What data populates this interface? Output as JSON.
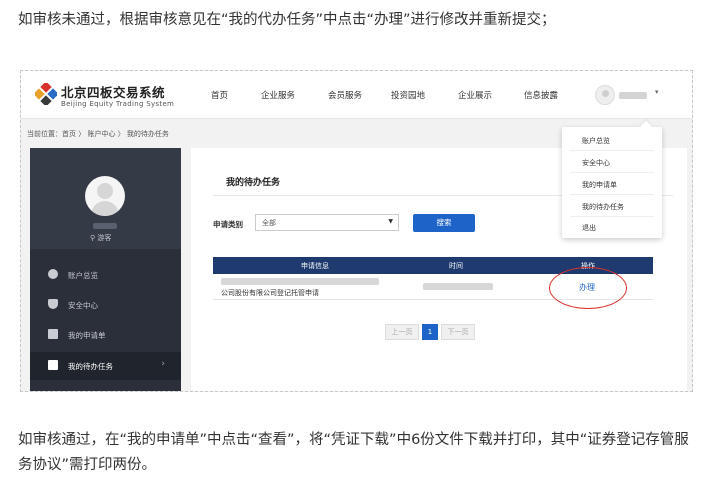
{
  "captions": {
    "top": "如审核未通过，根据审核意见在“我的代办任务”中点击“办理”进行修改并重新提交；",
    "bottom": "如审核通过，在“我的申请单”中点击“查看”，将“凭证下载”中6份文件下载并打印，其中“证券登记存管服务协议”需打印两份。"
  },
  "header": {
    "logo_cn": "北京四板交易系统",
    "logo_en": "Beijing Equity Trading System",
    "nav": [
      "首页",
      "企业服务",
      "会员服务",
      "投资园地",
      "企业展示",
      "信息披露"
    ],
    "user_caret": "▾"
  },
  "breadcrumb": "当前位置：首页 〉 账户中心 〉 我的待办任务",
  "sidebar": {
    "role": "游客",
    "items": [
      {
        "label": "账户总览",
        "icon": "account-icon"
      },
      {
        "label": "安全中心",
        "icon": "shield-icon"
      },
      {
        "label": "我的申请单",
        "icon": "document-icon"
      },
      {
        "label": "我的待办任务",
        "icon": "task-icon"
      }
    ],
    "chevron": "›"
  },
  "main": {
    "title": "我的待办任务",
    "filter_label": "申请类别",
    "filter_value": "全部",
    "search_button": "搜索",
    "table": {
      "headers": [
        "申请信息",
        "时间",
        "操作"
      ],
      "rows": [
        {
          "name": "公司股份有限公司登记托管申请",
          "action": "办理"
        }
      ]
    },
    "pager": {
      "prev": "上一页",
      "current": "1",
      "next": "下一页"
    }
  },
  "dropdown": {
    "items": [
      "账户总览",
      "安全中心",
      "我的申请单",
      "我的待办任务",
      "退出"
    ]
  },
  "colors": {
    "primary": "#1e64c8",
    "table_header": "#1e3a6e",
    "sidebar": "#2b2f3a",
    "highlight_circle": "#d9312b"
  }
}
